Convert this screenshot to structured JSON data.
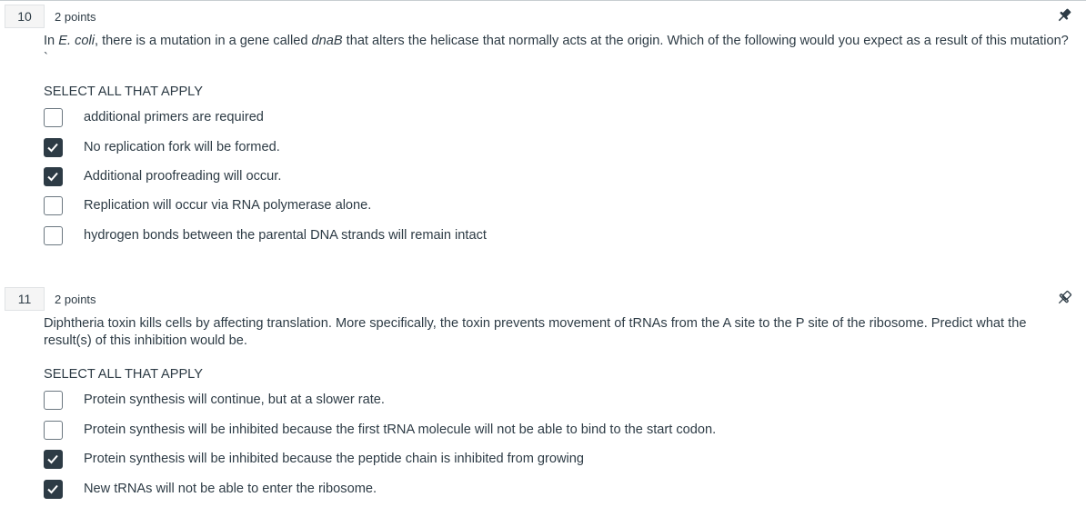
{
  "questions": [
    {
      "number": "10",
      "points": "2 points",
      "pin_icon": "pin-filled-icon",
      "text_parts": {
        "a": "In ",
        "b": "E. coli",
        "c": ", there is a mutation in a gene called ",
        "d": "dnaB",
        "e": " that alters the helicase that normally acts at the origin. Which of the following would you expect as a result of this mutation?`"
      },
      "instruction": "SELECT ALL THAT APPLY",
      "options": [
        {
          "label": "additional primers are required",
          "checked": false
        },
        {
          "label": "No replication fork will be formed.",
          "checked": true
        },
        {
          "label": "Additional proofreading will occur.",
          "checked": true
        },
        {
          "label": "Replication will occur via RNA polymerase alone.",
          "checked": false
        },
        {
          "label": "hydrogen bonds between the parental DNA strands will remain intact",
          "checked": false
        }
      ]
    },
    {
      "number": "11",
      "points": "2 points",
      "pin_icon": "pin-outline-icon",
      "text": "Diphtheria toxin kills cells by affecting translation. More specifically, the toxin prevents movement of tRNAs from the A site to the P site of the ribosome. Predict what the result(s) of this inhibition would be.",
      "instruction": "SELECT ALL THAT APPLY",
      "options": [
        {
          "label": "Protein synthesis will continue, but at a slower rate.",
          "checked": false
        },
        {
          "label": "Protein synthesis will be inhibited because the first tRNA molecule will not be able to bind to the start codon.",
          "checked": false
        },
        {
          "label": "Protein synthesis will be inhibited because the peptide chain is inhibited from growing",
          "checked": true
        },
        {
          "label": "New tRNAs will not be able to enter the ribosome.",
          "checked": true
        }
      ]
    }
  ],
  "colors": {
    "text": "#2d3b45",
    "checkbox_checked": "#2d3b45",
    "checkbox_border": "#6b7780",
    "number_bg": "#f5f5f5"
  }
}
